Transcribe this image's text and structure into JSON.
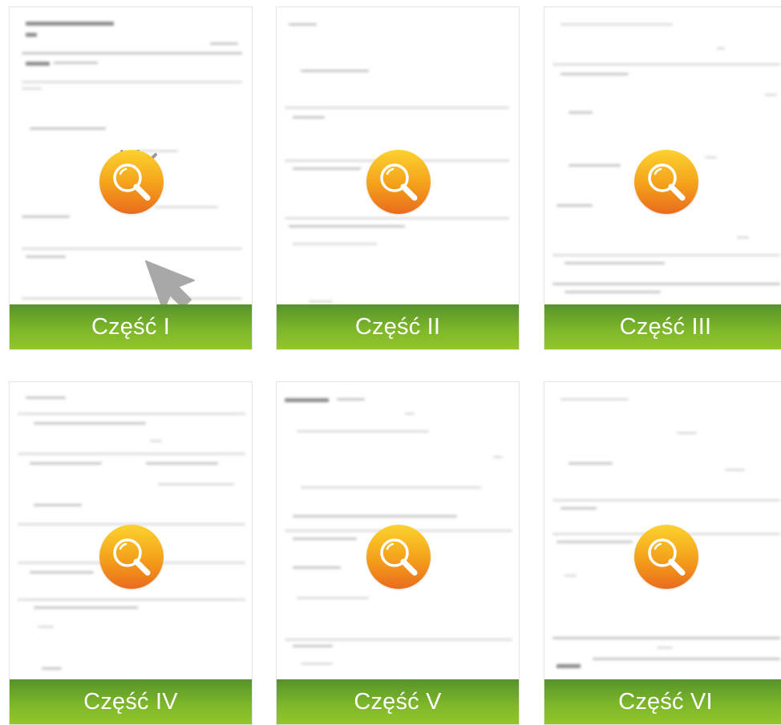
{
  "cards": [
    {
      "label": "Część I"
    },
    {
      "label": "Część II"
    },
    {
      "label": "Część III"
    },
    {
      "label": "Część IV"
    },
    {
      "label": "Część V"
    },
    {
      "label": "Część VI"
    }
  ],
  "colors": {
    "banner_top": "#56922a",
    "banner_bottom": "#94c62a",
    "zoom_top": "#fcd230",
    "zoom_bottom": "#ea6b1c"
  },
  "icons": {
    "zoom": "magnifier-icon",
    "pointer": "cursor-arrow-icon"
  }
}
